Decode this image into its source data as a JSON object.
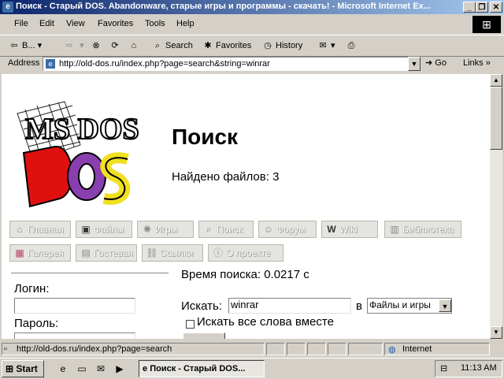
{
  "window": {
    "title": "Поиск - Старый DOS. Abandonware, старые игры и программы - скачать! - Microsoft Internet Ex...",
    "controls": [
      "_",
      "❐",
      "✕"
    ]
  },
  "menu": [
    "File",
    "Edit",
    "View",
    "Favorites",
    "Tools",
    "Help"
  ],
  "toolbar": {
    "back": "B...",
    "search": "Search",
    "favorites": "Favorites",
    "history": "History"
  },
  "address": {
    "label": "Address",
    "url": "http://old-dos.ru/index.php?page=search&string=winrar",
    "go": "Go",
    "links": "Links"
  },
  "page": {
    "heading": "Поиск",
    "found": "Найдено файлов: 3",
    "logo_text": "MS DOS",
    "nav_row1": [
      {
        "label": "Главная",
        "icon": "home-icon"
      },
      {
        "label": "Файлы",
        "icon": "files-icon"
      },
      {
        "label": "Игры",
        "icon": "games-icon"
      },
      {
        "label": "Поиск",
        "icon": "search-icon"
      },
      {
        "label": "Форум",
        "icon": "forum-icon"
      },
      {
        "label": "Wiki",
        "icon": "wiki-icon"
      },
      {
        "label": "Библиотека",
        "icon": "library-icon"
      }
    ],
    "nav_row2": [
      {
        "label": "Галерея",
        "icon": "gallery-icon"
      },
      {
        "label": "Гостевая",
        "icon": "guestbook-icon"
      },
      {
        "label": "Ссылки",
        "icon": "links-icon"
      },
      {
        "label": "О проекте",
        "icon": "info-icon"
      }
    ],
    "search_time": "Время поиска: 0.0217 с",
    "login_label": "Логин:",
    "password_label": "Пароль:",
    "search_label": "Искать:",
    "search_value": "winrar",
    "in_label": "в",
    "scope_value": "Файлы и игры",
    "all_words_label": "Искать все слова вместе"
  },
  "status": {
    "text": "http://old-dos.ru/index.php?page=search",
    "zone": "Internet"
  },
  "taskbar": {
    "start": "Start",
    "task": "Поиск - Старый DOS...",
    "clock": "11:13 AM"
  }
}
